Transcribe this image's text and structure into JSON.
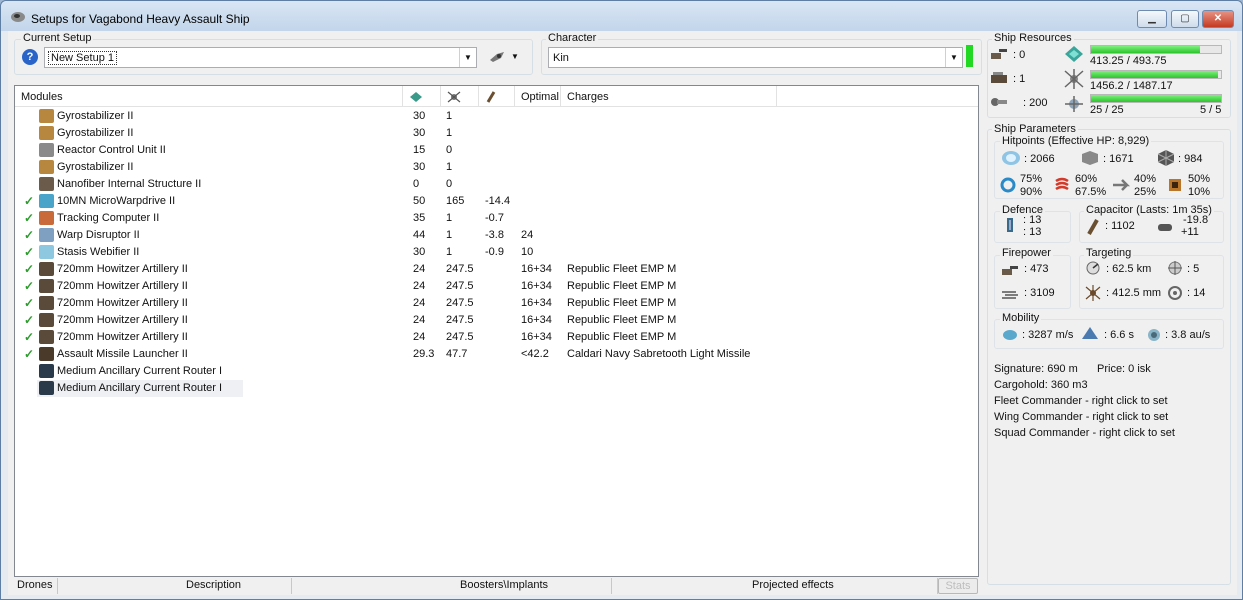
{
  "window": {
    "title": "Setups for Vagabond Heavy Assault Ship",
    "min": "▁",
    "max": "▢",
    "close": "✕"
  },
  "setup": {
    "label": "Current Setup",
    "value": "New Setup 1",
    "help": "?"
  },
  "character": {
    "label": "Character",
    "value": "Kin"
  },
  "modules": {
    "headers": {
      "name": "Modules",
      "optimal": "Optimal",
      "charges": "Charges"
    },
    "header_icons": [
      "cpu-icon",
      "powergrid-icon",
      "capacitor-icon"
    ],
    "rows": [
      {
        "active": "",
        "icon": "gyrostabilizer-icon",
        "color": "#b7873f",
        "name": "Gyrostabilizer II",
        "cpu": "30",
        "pg": "1",
        "cap": "",
        "optimal": "",
        "charges": ""
      },
      {
        "active": "",
        "icon": "gyrostabilizer-icon",
        "color": "#b7873f",
        "name": "Gyrostabilizer II",
        "cpu": "30",
        "pg": "1",
        "cap": "",
        "optimal": "",
        "charges": ""
      },
      {
        "active": "",
        "icon": "reactor-control-icon",
        "color": "#8a8a8a",
        "name": "Reactor Control Unit II",
        "cpu": "15",
        "pg": "0",
        "cap": "",
        "optimal": "",
        "charges": ""
      },
      {
        "active": "",
        "icon": "gyrostabilizer-icon",
        "color": "#b7873f",
        "name": "Gyrostabilizer II",
        "cpu": "30",
        "pg": "1",
        "cap": "",
        "optimal": "",
        "charges": ""
      },
      {
        "active": "",
        "icon": "nanofiber-icon",
        "color": "#6b5b4b",
        "name": "Nanofiber Internal Structure II",
        "cpu": "0",
        "pg": "0",
        "cap": "",
        "optimal": "",
        "charges": ""
      },
      {
        "active": "✓",
        "icon": "microwarpdrive-icon",
        "color": "#4aa3c8",
        "name": "10MN MicroWarpdrive II",
        "cpu": "50",
        "pg": "165",
        "cap": "-14.4",
        "optimal": "",
        "charges": ""
      },
      {
        "active": "✓",
        "icon": "tracking-computer-icon",
        "color": "#c86a3a",
        "name": "Tracking Computer II",
        "cpu": "35",
        "pg": "1",
        "cap": "-0.7",
        "optimal": "",
        "charges": ""
      },
      {
        "active": "✓",
        "icon": "warp-disruptor-icon",
        "color": "#7fa0c0",
        "name": "Warp Disruptor II",
        "cpu": "44",
        "pg": "1",
        "cap": "-3.8",
        "optimal": "24",
        "charges": ""
      },
      {
        "active": "✓",
        "icon": "stasis-webifier-icon",
        "color": "#8ec8e0",
        "name": "Stasis Webifier II",
        "cpu": "30",
        "pg": "1",
        "cap": "-0.9",
        "optimal": "10",
        "charges": ""
      },
      {
        "active": "✓",
        "icon": "artillery-icon",
        "color": "#5a4a3a",
        "name": "720mm Howitzer Artillery II",
        "cpu": "24",
        "pg": "247.5",
        "cap": "",
        "optimal": "16+34",
        "charges": "Republic Fleet EMP M"
      },
      {
        "active": "✓",
        "icon": "artillery-icon",
        "color": "#5a4a3a",
        "name": "720mm Howitzer Artillery II",
        "cpu": "24",
        "pg": "247.5",
        "cap": "",
        "optimal": "16+34",
        "charges": "Republic Fleet EMP M"
      },
      {
        "active": "✓",
        "icon": "artillery-icon",
        "color": "#5a4a3a",
        "name": "720mm Howitzer Artillery II",
        "cpu": "24",
        "pg": "247.5",
        "cap": "",
        "optimal": "16+34",
        "charges": "Republic Fleet EMP M"
      },
      {
        "active": "✓",
        "icon": "artillery-icon",
        "color": "#5a4a3a",
        "name": "720mm Howitzer Artillery II",
        "cpu": "24",
        "pg": "247.5",
        "cap": "",
        "optimal": "16+34",
        "charges": "Republic Fleet EMP M"
      },
      {
        "active": "✓",
        "icon": "artillery-icon",
        "color": "#5a4a3a",
        "name": "720mm Howitzer Artillery II",
        "cpu": "24",
        "pg": "247.5",
        "cap": "",
        "optimal": "16+34",
        "charges": "Republic Fleet EMP M"
      },
      {
        "active": "✓",
        "icon": "missile-launcher-icon",
        "color": "#4a3a2a",
        "name": "Assault Missile Launcher II",
        "cpu": "29.3",
        "pg": "47.7",
        "cap": "",
        "optimal": "<42.2",
        "charges": "Caldari Navy Sabretooth Light Missile"
      },
      {
        "active": "",
        "icon": "rig-icon",
        "color": "#2a3a4a",
        "name": "Medium Ancillary Current Router I",
        "cpu": "",
        "pg": "",
        "cap": "",
        "optimal": "",
        "charges": ""
      },
      {
        "active": "",
        "icon": "rig-icon",
        "color": "#2a3a4a",
        "name": "Medium Ancillary Current Router I",
        "cpu": "",
        "pg": "",
        "cap": "",
        "optimal": "",
        "charges": ""
      }
    ]
  },
  "tabs": [
    "Drones",
    "Description",
    "Boosters\\Implants",
    "Projected effects",
    "Stats"
  ],
  "resources": {
    "label": "Ship Resources",
    "turret": ": 0",
    "launcher": ": 1",
    "calibration": ": 200",
    "cpu": {
      "text": "413.25 / 493.75",
      "fraction": 0.837
    },
    "powergrid": {
      "text": "1456.2 / 1487.17",
      "fraction": 0.979
    },
    "drones": {
      "text": "25 / 25",
      "fraction": 1.0,
      "extra": "5 / 5"
    }
  },
  "params": {
    "label": "Ship Parameters",
    "hitpoints": {
      "label": "Hitpoints (Effective HP: 8,929)",
      "shield": ": 2066",
      "armor": ": 1671",
      "structure": ": 984",
      "em": [
        "75%",
        "90%"
      ],
      "thermal": [
        "60%",
        "67.5%"
      ],
      "kinetic": [
        "40%",
        "25%"
      ],
      "explosive": [
        "50%",
        "10%"
      ]
    },
    "defence": {
      "label": "Defence",
      "a": ": 13",
      "b": ": 13"
    },
    "capacitor": {
      "label": "Capacitor (Lasts: 1m 35s)",
      "amount": ": 1102",
      "delta": "-19.8",
      "recharge": "+11"
    },
    "firepower": {
      "label": "Firepower",
      "dps": ": 473",
      "volley": ": 3109"
    },
    "targeting": {
      "label": "Targeting",
      "range": ": 62.5 km",
      "targets": ": 5",
      "scan": ": 412.5 mm",
      "sensor": ": 14"
    },
    "mobility": {
      "label": "Mobility",
      "speed": ": 3287 m/s",
      "align": ": 6.6 s",
      "warp": ": 3.8 au/s"
    },
    "signature": "Signature: 690 m",
    "price": "Price: 0 isk",
    "cargo": "Cargohold: 360 m3",
    "fleet": "Fleet Commander - right click to set",
    "wing": "Wing Commander - right click to set",
    "squad": "Squad Commander - right click to set"
  },
  "colors": {
    "bar_fill": "#2cc52c",
    "check": "#2d9c2d",
    "window_border": "#5f7ea3"
  }
}
